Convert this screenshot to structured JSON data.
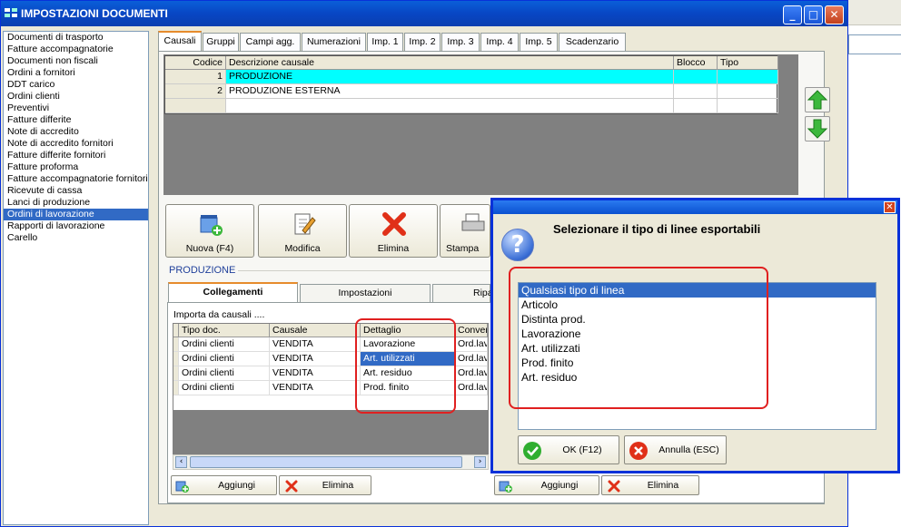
{
  "window": {
    "title": "IMPOSTAZIONI DOCUMENTI",
    "min": "_",
    "max": "□",
    "close": "✕"
  },
  "sidebar": {
    "items": [
      "Documenti di trasporto",
      "Fatture accompagnatorie",
      "Documenti non fiscali",
      "Ordini a fornitori",
      "DDT carico",
      "Ordini clienti",
      "Preventivi",
      "Fatture differite",
      "Note di accredito",
      "Note di accredito fornitori",
      "Fatture differite fornitori",
      "Fatture proforma",
      "Fatture accompagnatorie fornitori",
      "Ricevute di cassa",
      "Lanci di produzione",
      "Ordini di lavorazione",
      "Rapporti di lavorazione",
      "Carello"
    ],
    "selected_index": 15
  },
  "tabs": [
    "Causali",
    "Gruppi",
    "Campi agg.",
    "Numerazioni",
    "Imp. 1",
    "Imp. 2",
    "Imp. 3",
    "Imp. 4",
    "Imp. 5",
    "Scadenzario"
  ],
  "causali_grid": {
    "headers": [
      "Codice",
      "Descrizione causale",
      "Blocco",
      "Tipo"
    ],
    "rows": [
      [
        "1",
        "PRODUZIONE",
        "",
        ""
      ],
      [
        "2",
        "PRODUZIONE ESTERNA",
        "",
        ""
      ]
    ]
  },
  "toolbar": {
    "nuova": "Nuova (F4)",
    "modifica": "Modifica",
    "elimina": "Elimina",
    "stampa": "Stampa"
  },
  "group_label": "PRODUZIONE",
  "subtabs": [
    "Collegamenti",
    "Impostazioni",
    "Ripa"
  ],
  "import_label": "Importa da causali ....",
  "link_grid": {
    "headers": [
      "Tipo doc.",
      "Causale",
      "Dettaglio",
      "Convers"
    ],
    "rows": [
      [
        "Ordini clienti",
        "VENDITA",
        "Lavorazione",
        "Ord.lav."
      ],
      [
        "Ordini clienti",
        "VENDITA",
        "Art. utilizzati",
        "Ord.lav."
      ],
      [
        "Ordini clienti",
        "VENDITA",
        "Art. residuo",
        "Ord.lav."
      ],
      [
        "Ordini clienti",
        "VENDITA",
        "Prod. finito",
        "Ord.lav."
      ]
    ],
    "selected_row": 1
  },
  "bottom_buttons": {
    "aggiungi": "Aggiungi",
    "elimina": "Elimina"
  },
  "dialog": {
    "title": "Selezionare il tipo di linee esportabili",
    "items": [
      "Qualsiasi tipo di linea",
      "Articolo",
      "Distinta prod.",
      "Lavorazione",
      "Art. utilizzati",
      "Prod. finito",
      "Art. residuo"
    ],
    "selected_index": 0,
    "ok": "OK (F12)",
    "cancel": "Annulla (ESC)"
  },
  "colors": {
    "selection": "#316ac5",
    "row_highlight": "#00ffff",
    "annotation": "#e02020",
    "titlebar": "#0a50d0"
  }
}
